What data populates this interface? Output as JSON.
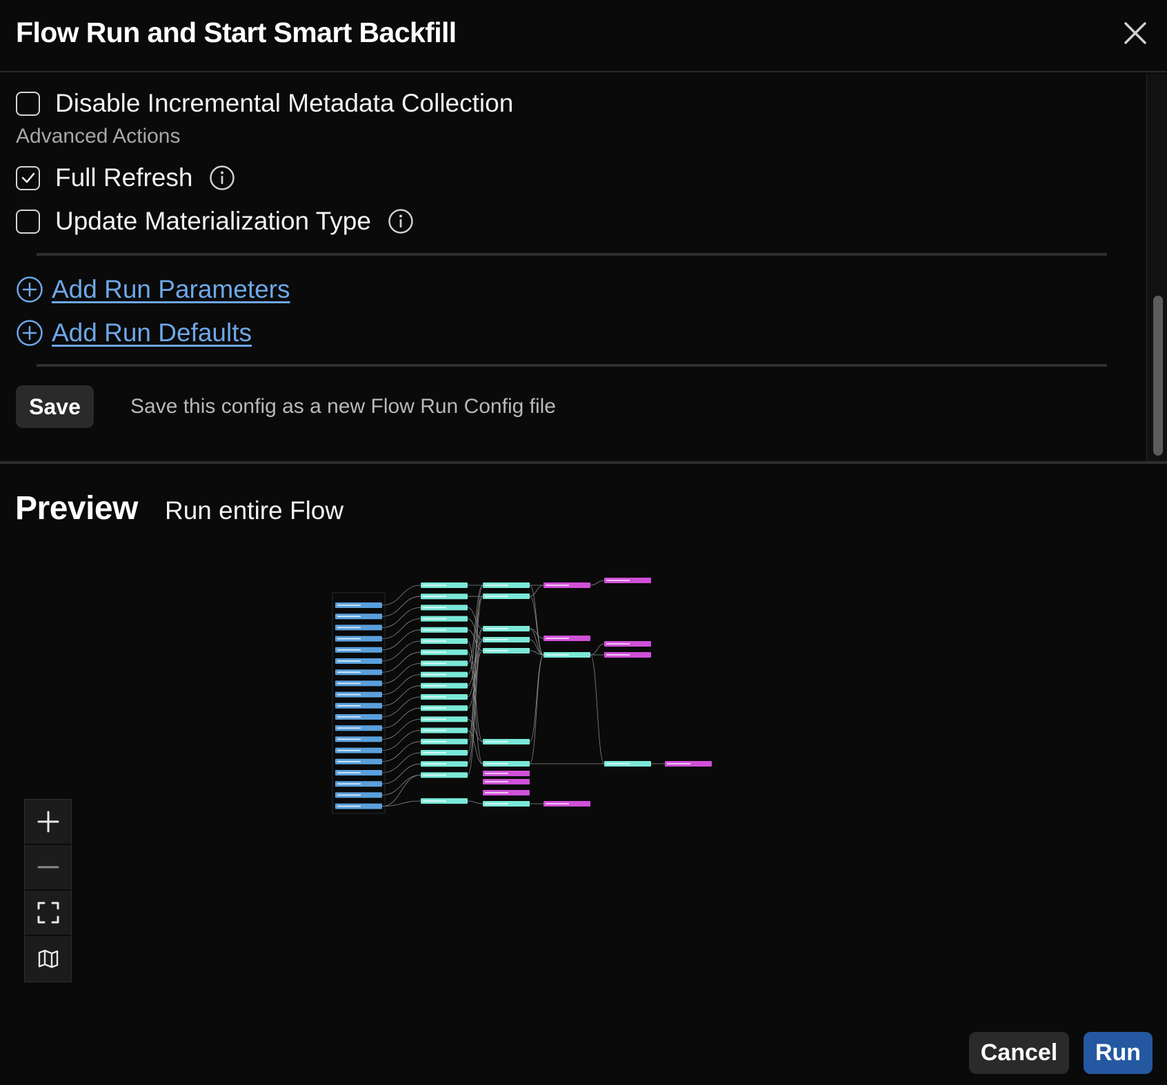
{
  "dialog": {
    "title": "Flow Run and Start Smart Backfill",
    "close_icon": "close-icon"
  },
  "options": {
    "disable_incremental": {
      "label": "Disable Incremental Metadata Collection",
      "checked": false
    },
    "section_label": "Advanced Actions",
    "full_refresh": {
      "label": "Full Refresh",
      "checked": true,
      "icon": "info-icon"
    },
    "update_materialization": {
      "label": "Update Materialization Type",
      "checked": false,
      "icon": "info-icon"
    }
  },
  "links": {
    "add_run_parameters": "Add Run Parameters",
    "add_run_defaults": "Add Run Defaults",
    "icon": "plus-circle-icon"
  },
  "save": {
    "label": "Save",
    "description": "Save this config as a new Flow Run Config file"
  },
  "preview": {
    "title": "Preview",
    "subtitle": "Run entire Flow"
  },
  "graph": {
    "colors": {
      "source": "#5aa0dc",
      "model": "#7ae8d8",
      "output": "#d050d8",
      "edge": "#8a8a8a"
    }
  },
  "zoom_controls": [
    "zoom-in-icon",
    "zoom-out-icon",
    "fit-view-icon",
    "minimap-icon"
  ],
  "footer": {
    "cancel_label": "Cancel",
    "run_label": "Run"
  },
  "colors": {
    "background": "#0a0a0a",
    "link": "#6ea8e8",
    "primary_button": "#2458a0"
  }
}
